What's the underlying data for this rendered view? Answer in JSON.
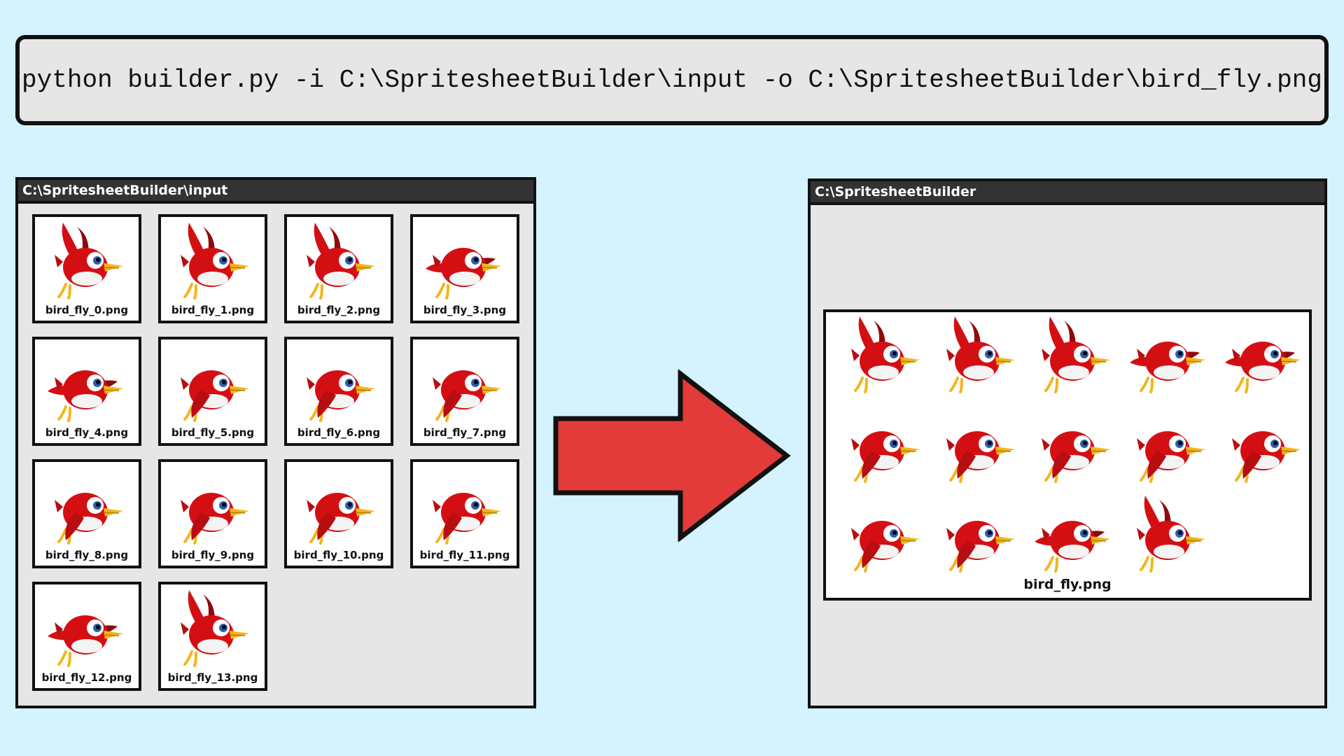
{
  "command": {
    "text": "python builder.py -i C:\\SpritesheetBuilder\\input -o C:\\SpritesheetBuilder\\bird_fly.png"
  },
  "input_window": {
    "title": "C:\\SpritesheetBuilder\\input",
    "files": [
      {
        "name": "bird_fly_0.png",
        "wing": "up"
      },
      {
        "name": "bird_fly_1.png",
        "wing": "up"
      },
      {
        "name": "bird_fly_2.png",
        "wing": "up"
      },
      {
        "name": "bird_fly_3.png",
        "wing": "mid"
      },
      {
        "name": "bird_fly_4.png",
        "wing": "mid"
      },
      {
        "name": "bird_fly_5.png",
        "wing": "down"
      },
      {
        "name": "bird_fly_6.png",
        "wing": "down"
      },
      {
        "name": "bird_fly_7.png",
        "wing": "down"
      },
      {
        "name": "bird_fly_8.png",
        "wing": "down"
      },
      {
        "name": "bird_fly_9.png",
        "wing": "down"
      },
      {
        "name": "bird_fly_10.png",
        "wing": "down"
      },
      {
        "name": "bird_fly_11.png",
        "wing": "down"
      },
      {
        "name": "bird_fly_12.png",
        "wing": "mid"
      },
      {
        "name": "bird_fly_13.png",
        "wing": "up"
      }
    ]
  },
  "output_window": {
    "title": "C:\\SpritesheetBuilder",
    "spritesheet_label": "bird_fly.png",
    "frame_count": 14
  },
  "colors": {
    "background": "#d4f3ff",
    "arrow": "#e33a3a",
    "bird_body": "#d40f14",
    "bird_wing_dark": "#8e0a0d",
    "beak": "#f2b51c",
    "eye_iris": "#2a5fb0"
  },
  "icons": {
    "sprite": "bird-sprite-icon",
    "arrow": "right-arrow-icon"
  }
}
